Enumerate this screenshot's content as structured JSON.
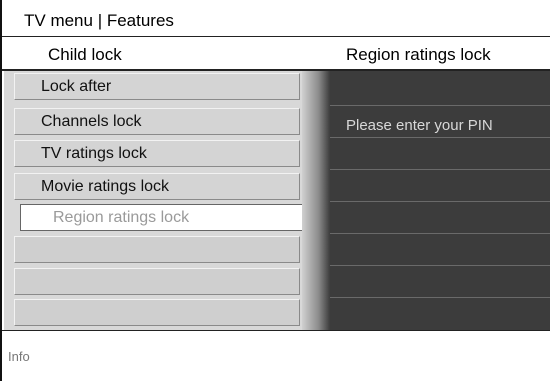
{
  "topbar": {
    "title": "TV menu | Features"
  },
  "header": {
    "left": "Child lock",
    "right": "Region ratings lock"
  },
  "menu": {
    "items": [
      {
        "label": "Lock after"
      },
      {
        "label": "Channels lock"
      },
      {
        "label": "TV ratings lock"
      },
      {
        "label": "Movie ratings lock"
      },
      {
        "label": "Region ratings lock",
        "selected": true
      }
    ]
  },
  "panel": {
    "message": "Please enter your PIN"
  },
  "footer": {
    "info": "Info"
  },
  "colors": {
    "panel_bg": "#3c3c3c",
    "menu_bg": "#d8d8d8",
    "selected_text": "#9a9a9a"
  }
}
